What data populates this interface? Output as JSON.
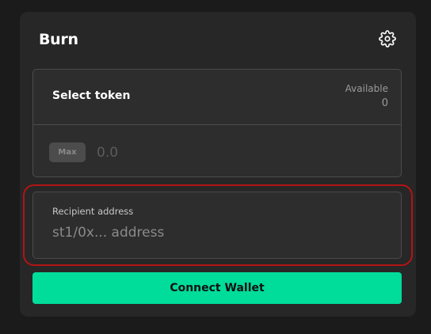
{
  "header": {
    "title": "Burn",
    "settings_icon": "gear-icon"
  },
  "token": {
    "select_label": "Select token",
    "available_label": "Available",
    "available_value": "0"
  },
  "amount": {
    "max_label": "Max",
    "placeholder": "0.0"
  },
  "recipient": {
    "label": "Recipient address",
    "placeholder": "st1/0x... address"
  },
  "action": {
    "connect_label": "Connect Wallet"
  },
  "colors": {
    "background": "#1b1b1b",
    "card": "#272727",
    "accent": "#00dc9a",
    "highlight_outline": "#b31414"
  }
}
